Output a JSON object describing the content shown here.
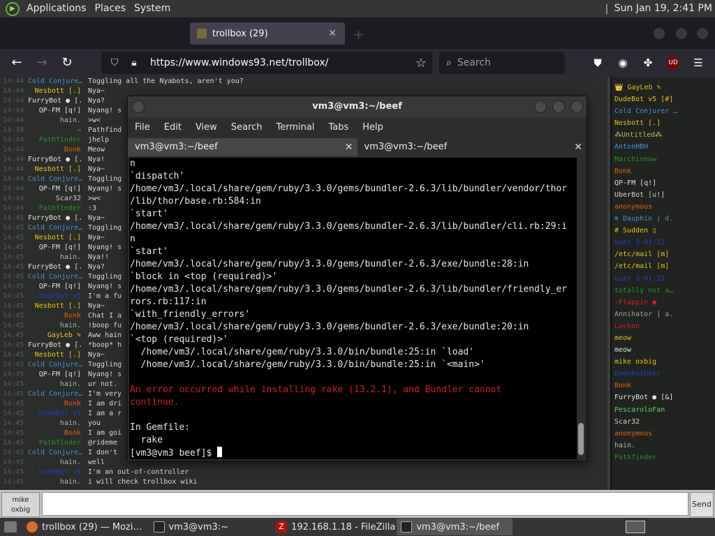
{
  "panel": {
    "menus": [
      "Applications",
      "Places",
      "System"
    ],
    "clock": "Sun Jan 19,  2:41 PM"
  },
  "browser": {
    "tabs": [
      {
        "label": "",
        "active": false
      },
      {
        "label": "trollbox (29)",
        "active": true
      }
    ],
    "url": "https://www.windows93.net/trollbox/",
    "search_placeholder": "Search"
  },
  "chat": {
    "messages": [
      {
        "time": "14:44",
        "nick": "Cold Conjure…",
        "color": "#4a90d0",
        "text": "Toggling all the Nyabots, aren't you?"
      },
      {
        "time": "14:44",
        "nick": "Nesbott [.]",
        "color": "#e6c020",
        "text": "Nya~"
      },
      {
        "time": "14:44",
        "nick": "FurryBot ● [.",
        "color": "#e0e0e0",
        "text": "Nya?"
      },
      {
        "time": "14:44",
        "nick": "QP-FM [q!]",
        "color": "#e0e0e0",
        "text": "Nyang! s"
      },
      {
        "time": "14:44",
        "nick": "hain.",
        "color": "#b0b8b0",
        "text": ">w<"
      },
      {
        "time": "14:39",
        "nick": "→",
        "color": "#39a839",
        "text": "Pathfind"
      },
      {
        "time": "14:44",
        "nick": "Pathfinder",
        "color": "#2f8f2f",
        "text": "jhelp"
      },
      {
        "time": "14:44",
        "nick": "Bonk",
        "color": "#e06010",
        "text": "Meow"
      },
      {
        "time": "14:44",
        "nick": "FurryBot ● [.",
        "color": "#e0e0e0",
        "text": "Nya!"
      },
      {
        "time": "14:44",
        "nick": "Nesbott [.]",
        "color": "#e6c020",
        "text": "Nya~"
      },
      {
        "time": "14:44",
        "nick": "Cold Conjure…",
        "color": "#4a90d0",
        "text": "Toggling"
      },
      {
        "time": "14:44",
        "nick": "QP-FM [q!]",
        "color": "#e0e0e0",
        "text": "Nyang! s"
      },
      {
        "time": "14:44",
        "nick": "Scar32",
        "color": "#d0d0d0",
        "text": ">w<"
      },
      {
        "time": "14:44",
        "nick": "Pathfinder",
        "color": "#2f8f2f",
        "text": ":3"
      },
      {
        "time": "14:45",
        "nick": "FurryBot ● [.",
        "color": "#e0e0e0",
        "text": "Nya~"
      },
      {
        "time": "14:45",
        "nick": "Cold Conjure…",
        "color": "#4a90d0",
        "text": "Toggling"
      },
      {
        "time": "14:45",
        "nick": "Nesbott [.]",
        "color": "#e6c020",
        "text": "Nya~"
      },
      {
        "time": "14:45",
        "nick": "QP-FM [q!]",
        "color": "#e0e0e0",
        "text": "Nyang! s"
      },
      {
        "time": "14:45",
        "nick": "hain.",
        "color": "#b0b8b0",
        "text": "Nya!!"
      },
      {
        "time": "14:45",
        "nick": "FurryBot ● [.",
        "color": "#e0e0e0",
        "text": "Nya?"
      },
      {
        "time": "14:45",
        "nick": "Cold Conjure…",
        "color": "#4a90d0",
        "text": "Toggling"
      },
      {
        "time": "14:45",
        "nick": "QP-FM [q!]",
        "color": "#e0e0e0",
        "text": "Nyang! s"
      },
      {
        "time": "14:45",
        "nick": "DudeBot v5",
        "color": "#2040c0",
        "text": "I'm a fu"
      },
      {
        "time": "14:45",
        "nick": "Nesbott [.]",
        "color": "#e6c020",
        "text": "Nya~"
      },
      {
        "time": "14:45",
        "nick": "Bonk",
        "color": "#e06010",
        "text": "Chat I a"
      },
      {
        "time": "14:45",
        "nick": "hain.",
        "color": "#b0b8b0",
        "text": "!boop fu"
      },
      {
        "time": "14:45",
        "nick": "GayLeb ✎",
        "color": "#e6c020",
        "text": "Aww hain"
      },
      {
        "time": "14:45",
        "nick": "FurryBot ● [.",
        "color": "#e0e0e0",
        "text": "*boop* h"
      },
      {
        "time": "14:45",
        "nick": "Nesbott [.]",
        "color": "#e6c020",
        "text": "Nya~"
      },
      {
        "time": "14:45",
        "nick": "Cold Conjure…",
        "color": "#4a90d0",
        "text": "Toggling"
      },
      {
        "time": "14:45",
        "nick": "QP-FM [q!]",
        "color": "#e0e0e0",
        "text": "Nyang! s"
      },
      {
        "time": "14:45",
        "nick": "hain.",
        "color": "#b0b8b0",
        "text": "ur not."
      },
      {
        "time": "14:45",
        "nick": "Cold Conjure…",
        "color": "#4a90d0",
        "text": "I'm very"
      },
      {
        "time": "14:45",
        "nick": "Bonk",
        "color": "#e06010",
        "text": "I am dri"
      },
      {
        "time": "14:45",
        "nick": "DudeBot v5",
        "color": "#2040c0",
        "text": "I am a r"
      },
      {
        "time": "14:45",
        "nick": "hain.",
        "color": "#b0b8b0",
        "text": "you"
      },
      {
        "time": "14:45",
        "nick": "Bonk",
        "color": "#e06010",
        "text": "I am goi"
      },
      {
        "time": "14:45",
        "nick": "Pathfinder",
        "color": "#2f8f2f",
        "text": "@rideme"
      },
      {
        "time": "14:45",
        "nick": "Cold Conjure…",
        "color": "#4a90d0",
        "text": "I don't"
      },
      {
        "time": "14:45",
        "nick": "hain.",
        "color": "#b0b8b0",
        "text": "well"
      },
      {
        "time": "14:45",
        "nick": "DudeBot v5",
        "color": "#2040c0",
        "text": "I'm an out-of-controller"
      },
      {
        "time": "14:45",
        "nick": "hain.",
        "color": "#b0b8b0",
        "text": "i will check trollbox wiki"
      }
    ],
    "users": [
      {
        "name": "👑 GayLeb ✎",
        "color": "#e6c020"
      },
      {
        "name": "DudeBot v5 [#]",
        "color": "#e6c020"
      },
      {
        "name": "Cold Conjurer …",
        "color": "#4a90d0"
      },
      {
        "name": "Nesbott [.]",
        "color": "#e6c020"
      },
      {
        "name": "⁂Untitled⁂",
        "color": "#b0c060"
      },
      {
        "name": "AntonHBH",
        "color": "#4a90d0"
      },
      {
        "name": "Marchinnow",
        "color": "#2f8f2f"
      },
      {
        "name": "Bonk",
        "color": "#e06010"
      },
      {
        "name": "QP-FM [q!]",
        "color": "#e0e0e0"
      },
      {
        "name": "UberBot [u!]",
        "color": "#d0d0d0"
      },
      {
        "name": "anonymous",
        "color": "#e06010"
      },
      {
        "name": "❄ Dauphin | d.",
        "color": "#4a90d0"
      },
      {
        "name": "# Sudden ▯",
        "color": "#e6c020"
      },
      {
        "name": "user 3-01-12",
        "color": "#2040c0"
      },
      {
        "name": "/etc/mail [m]",
        "color": "#e6c020"
      },
      {
        "name": "/etc/mail [m]",
        "color": "#e6c020"
      },
      {
        "name": "user 3-01-12",
        "color": "#2040c0"
      },
      {
        "name": "totally not a…",
        "color": "#2f8f2f"
      },
      {
        "name": "-Flappin ●",
        "color": "#d02020"
      },
      {
        "name": "Annihator | a.",
        "color": "#a0a0a0"
      },
      {
        "name": "Lockon",
        "color": "#d02020"
      },
      {
        "name": "meow",
        "color": "#e6c020"
      },
      {
        "name": "meow",
        "color": "#e0e0e0"
      },
      {
        "name": "mike oxbig",
        "color": "#e6c020"
      },
      {
        "name": "DudeBotUser",
        "color": "#2040c0"
      },
      {
        "name": "Bonk",
        "color": "#e06010"
      },
      {
        "name": "FurryBot ● [&]",
        "color": "#e0e0e0"
      },
      {
        "name": "PescaroloFan",
        "color": "#60d060"
      },
      {
        "name": "Scar32",
        "color": "#d0d0d0"
      },
      {
        "name": "anonymous",
        "color": "#e06010"
      },
      {
        "name": "hain.",
        "color": "#b0b8b0"
      },
      {
        "name": "Pathfinder",
        "color": "#2f8f2f"
      }
    ],
    "nick_button": "mike\noxbig",
    "send_label": "Send"
  },
  "terminal": {
    "title": "vm3@vm3:~/beef",
    "menu": [
      "File",
      "Edit",
      "View",
      "Search",
      "Terminal",
      "Tabs",
      "Help"
    ],
    "tabs": [
      "vm3@vm3:~/beef",
      "vm3@vm3:~/beef"
    ],
    "lines": [
      "n",
      "`dispatch'",
      "/home/vm3/.local/share/gem/ruby/3.3.0/gems/bundler-2.6.3/lib/bundler/vendor/thor",
      "/lib/thor/base.rb:584:in",
      "`start'",
      "/home/vm3/.local/share/gem/ruby/3.3.0/gems/bundler-2.6.3/lib/bundler/cli.rb:29:i",
      "n",
      "`start'",
      "/home/vm3/.local/share/gem/ruby/3.3.0/gems/bundler-2.6.3/exe/bundle:28:in",
      "`block in <top (required)>'",
      "/home/vm3/.local/share/gem/ruby/3.3.0/gems/bundler-2.6.3/lib/bundler/friendly_er",
      "rors.rb:117:in",
      "`with_friendly_errors'",
      "/home/vm3/.local/share/gem/ruby/3.3.0/gems/bundler-2.6.3/exe/bundle:20:in",
      "`<top (required)>'",
      "  /home/vm3/.local/share/gem/ruby/3.3.0/bin/bundle:25:in `load'",
      "  /home/vm3/.local/share/gem/ruby/3.3.0/bin/bundle:25:in `<main>'",
      ""
    ],
    "error_lines": [
      "An error occurred while installing rake (13.2.1), and Bundler cannot",
      "continue."
    ],
    "after_lines": [
      "",
      "In Gemfile:",
      "  rake"
    ],
    "prompt": "[vm3@vm3 beef]$ "
  },
  "taskbar": {
    "items": [
      {
        "label": "trollbox (29) — Mozi…",
        "icon": "firefox-icon",
        "active": false
      },
      {
        "label": "vm3@vm3:~",
        "icon": "terminal-icon",
        "active": false
      },
      {
        "label": "192.168.1.18 - FileZilla",
        "icon": "filezilla-icon",
        "active": false
      },
      {
        "label": "vm3@vm3:~/beef",
        "icon": "terminal-icon",
        "active": true
      }
    ]
  }
}
